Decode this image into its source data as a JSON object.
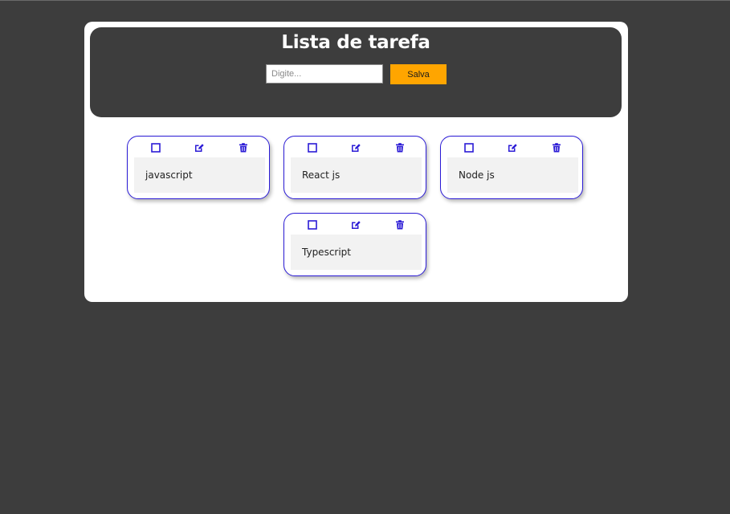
{
  "app": {
    "title": "Lista de tarefa"
  },
  "form": {
    "input_value": "",
    "input_placeholder": "Digite...",
    "save_label": "Salva"
  },
  "colors": {
    "page_bg": "#3d3d3d",
    "card_bg": "#ffffff",
    "accent_button": "#ffa500",
    "icon_and_border": "#2b1bd6",
    "task_body_bg": "#f2f2f2"
  },
  "icons": {
    "complete": "checkbox-icon",
    "edit": "edit-icon",
    "delete": "trash-icon"
  },
  "tasks": [
    {
      "text": "javascript"
    },
    {
      "text": "React js"
    },
    {
      "text": "Node js"
    },
    {
      "text": "Typescript"
    }
  ]
}
